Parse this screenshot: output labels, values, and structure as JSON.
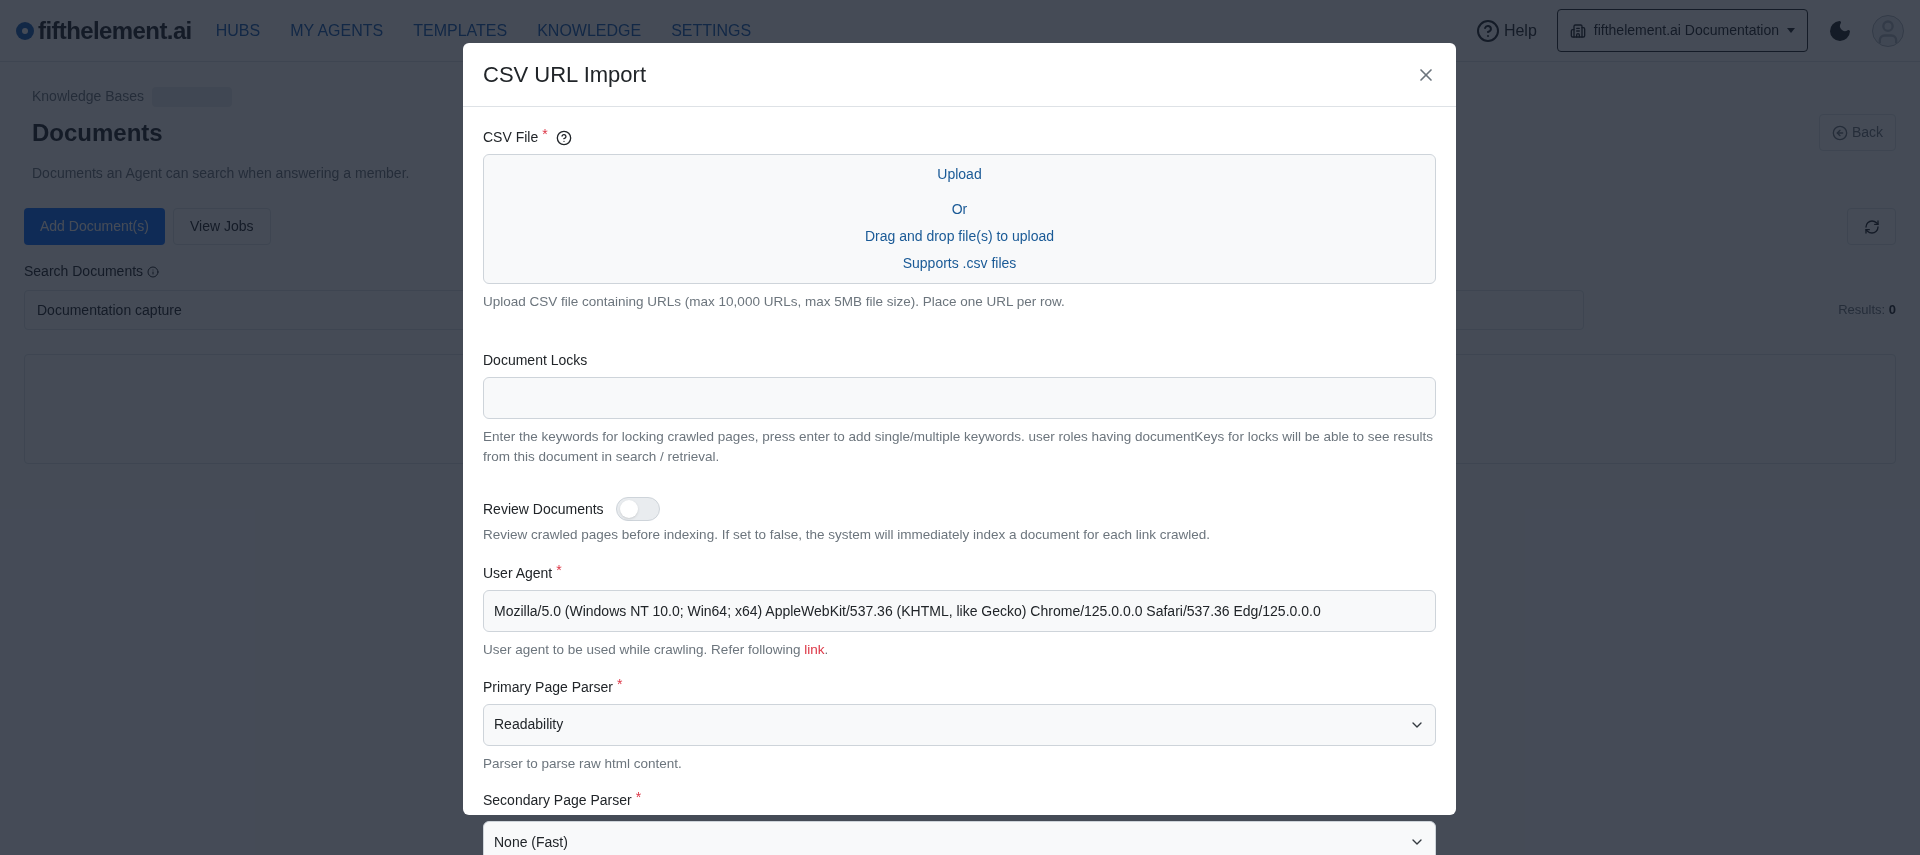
{
  "header": {
    "logo_text": "fifthelement.ai",
    "nav": [
      {
        "label": "HUBS"
      },
      {
        "label": "MY AGENTS"
      },
      {
        "label": "TEMPLATES"
      },
      {
        "label": "KNOWLEDGE"
      },
      {
        "label": "SETTINGS"
      }
    ],
    "help": "Help",
    "org_selector": "fifthelement.ai Documentation"
  },
  "page": {
    "breadcrumb": "Knowledge Bases",
    "title": "Documents",
    "subtitle": "Documents an Agent can search when answering a member.",
    "back": "Back",
    "add_button": "Add Document(s)",
    "jobs_button": "View Jobs",
    "search_label": "Search Documents",
    "search_value": "Documentation capture",
    "results_label": "Results:",
    "results_count": "0"
  },
  "modal": {
    "title": "CSV URL Import",
    "fields": [
      {
        "kind": "upload",
        "label": "CSV File",
        "required_mark": "*",
        "upload": "Upload",
        "or": "Or",
        "drag": "Drag and drop file(s) to upload",
        "supports": "Supports .csv files",
        "help": "Upload CSV file containing URLs (max 10,000 URLs, max 5MB file size). Place one URL per row."
      },
      {
        "kind": "tags",
        "label": "Document Locks",
        "help": "Enter the keywords for locking crawled pages, press enter to add single/multiple keywords. user roles having documentKeys for locks will be able to see results from this document in search / retrieval."
      },
      {
        "kind": "toggle",
        "label": "Review Documents",
        "on": false,
        "help": "Review crawled pages before indexing. If set to false, the system will immediately index a document for each link crawled."
      },
      {
        "kind": "text",
        "label": "User Agent",
        "required_mark": "*",
        "value": "Mozilla/5.0 (Windows NT 10.0; Win64; x64) AppleWebKit/537.36 (KHTML, like Gecko) Chrome/125.0.0.0 Safari/537.36 Edg/125.0.0.0",
        "help": "User agent to be used while crawling. Refer following",
        "help_link": "link",
        "help_end": "."
      },
      {
        "kind": "select",
        "label": "Primary Page Parser",
        "required_mark": "*",
        "value": "Readability",
        "help": "Parser to parse raw html content."
      },
      {
        "kind": "select",
        "label": "Secondary Page Parser",
        "required_mark": "*",
        "value": "None (Fast)"
      }
    ]
  }
}
